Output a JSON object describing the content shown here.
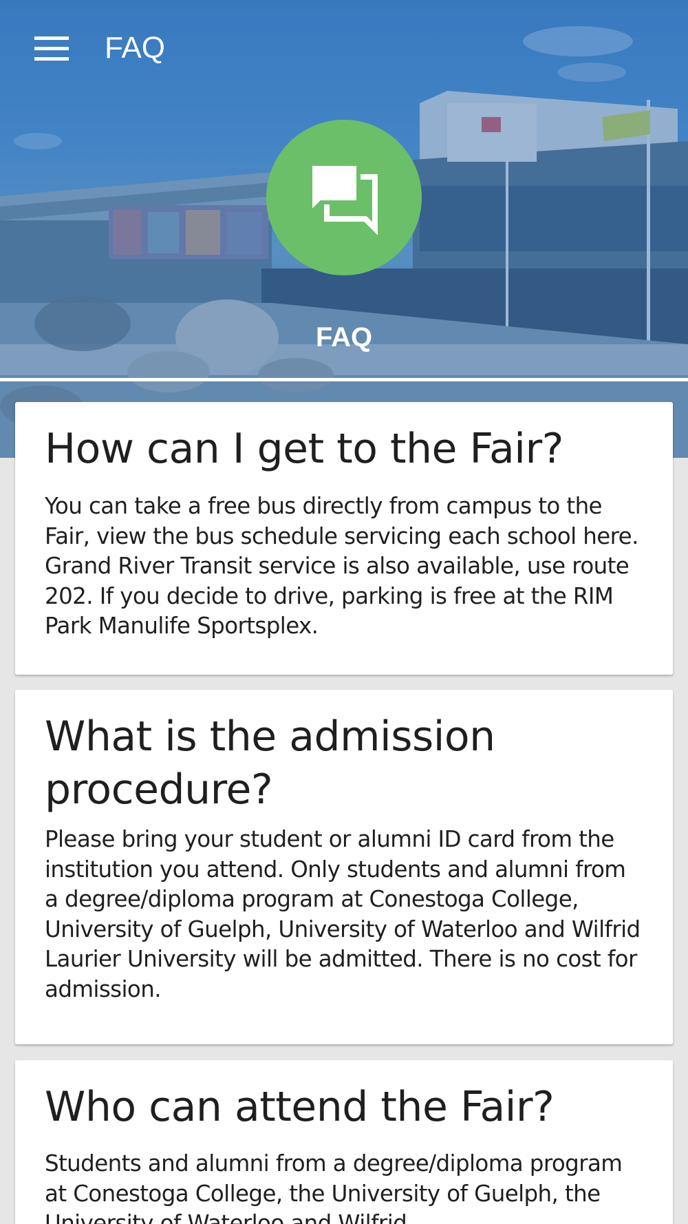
{
  "app_bar": {
    "title": "FAQ",
    "menu_icon": "hamburger-menu-icon"
  },
  "hero": {
    "icon": "chat-bubbles-icon",
    "label": "FAQ",
    "circle_color": "#6cbf69"
  },
  "faq": [
    {
      "question": "How can I get to the Fair?",
      "answer": "You can take a free bus directly from campus to the Fair, view the bus schedule servicing each school here. Grand River Transit service is also available, use route 202. If you decide to drive, parking is free at the RIM Park Manulife Sportsplex."
    },
    {
      "question": "What is the admission procedure?",
      "answer": "Please bring your student or alumni ID card from the institution you attend. Only students and alumni from a degree/diploma program at Conestoga College, University of Guelph, University of Waterloo and Wilfrid Laurier University will be admitted. There is no cost for admission."
    },
    {
      "question": "Who can attend the Fair?",
      "answer": "Students and alumni from a degree/diploma program at Conestoga College, the University of Guelph, the University of Waterloo and Wilfrid"
    }
  ]
}
